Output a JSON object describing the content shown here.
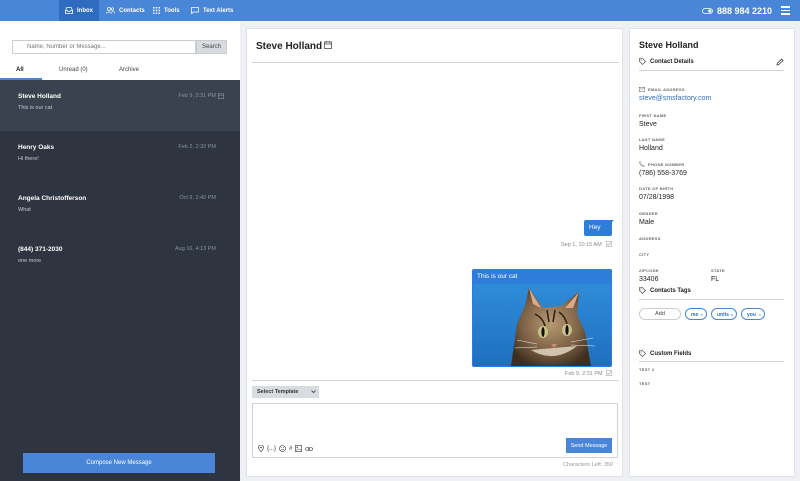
{
  "nav": {
    "inbox": "Inbox",
    "contacts": "Contacts",
    "tools": "Tools",
    "text_alerts": "Text Alerts",
    "phone": "888 984 2210"
  },
  "sidebar": {
    "search_placeholder": "Name, Number or Message...",
    "search_button": "Search",
    "tabs": [
      "All",
      "Unread (0)",
      "Archive"
    ],
    "conversations": [
      {
        "name": "Steve Holland",
        "time": "Feb 9, 2:31 PM",
        "preview": "This is our cat",
        "selected": true
      },
      {
        "name": "Henry Oaks",
        "time": "Feb 2, 2:32 PM",
        "preview": "Hi there!"
      },
      {
        "name": "Angela Christofferson",
        "time": "Oct 9, 2:40 PM",
        "preview": "What"
      },
      {
        "name": "(844) 371-2030",
        "time": "Aug 16, 4:13 PM",
        "preview": "one more"
      }
    ],
    "compose_button": "Compose New Message"
  },
  "conversation": {
    "title": "Steve Holland",
    "messages": [
      {
        "text": "Hey",
        "time": "Sep 1, 10:15 AM"
      },
      {
        "text": "This is our cat",
        "time": "Feb 9, 2:31 PM",
        "has_image": true
      }
    ],
    "template_select": "Select Template",
    "send_button": "Send Message",
    "chars_left": "Characters Left: 350",
    "variable_icon": "{...}",
    "hash_icon": "#"
  },
  "contact": {
    "name": "Steve Holland",
    "details_title": "Contact Details",
    "email_label": "EMAIL ADDRESS",
    "email": "steve@smsfactory.com",
    "first_name_label": "FIRST NAME",
    "first_name": "Steve",
    "last_name_label": "LAST NAME",
    "last_name": "Holland",
    "phone_label": "PHONE NUMBER",
    "phone": "(786) 558-3769",
    "dob_label": "DATE OF BIRTH",
    "dob": "07/28/1998",
    "gender_label": "GENDER",
    "gender": "Male",
    "address_label": "ADDRESS",
    "city_label": "CITY",
    "zip_label": "ZIPCODE",
    "zip": "33406",
    "state_label": "STATE",
    "state": "FL",
    "tags_title": "Contacts Tags",
    "add_tag": "Add",
    "tags": [
      "me",
      "units",
      "you"
    ],
    "custom_fields_title": "Custom Fields",
    "custom_fields": [
      "TEST 2",
      "TEST"
    ]
  },
  "colors": {
    "brand": "#4a86d8",
    "sidebar_bg": "#2e3440",
    "bubble": "#2f7ddb"
  }
}
